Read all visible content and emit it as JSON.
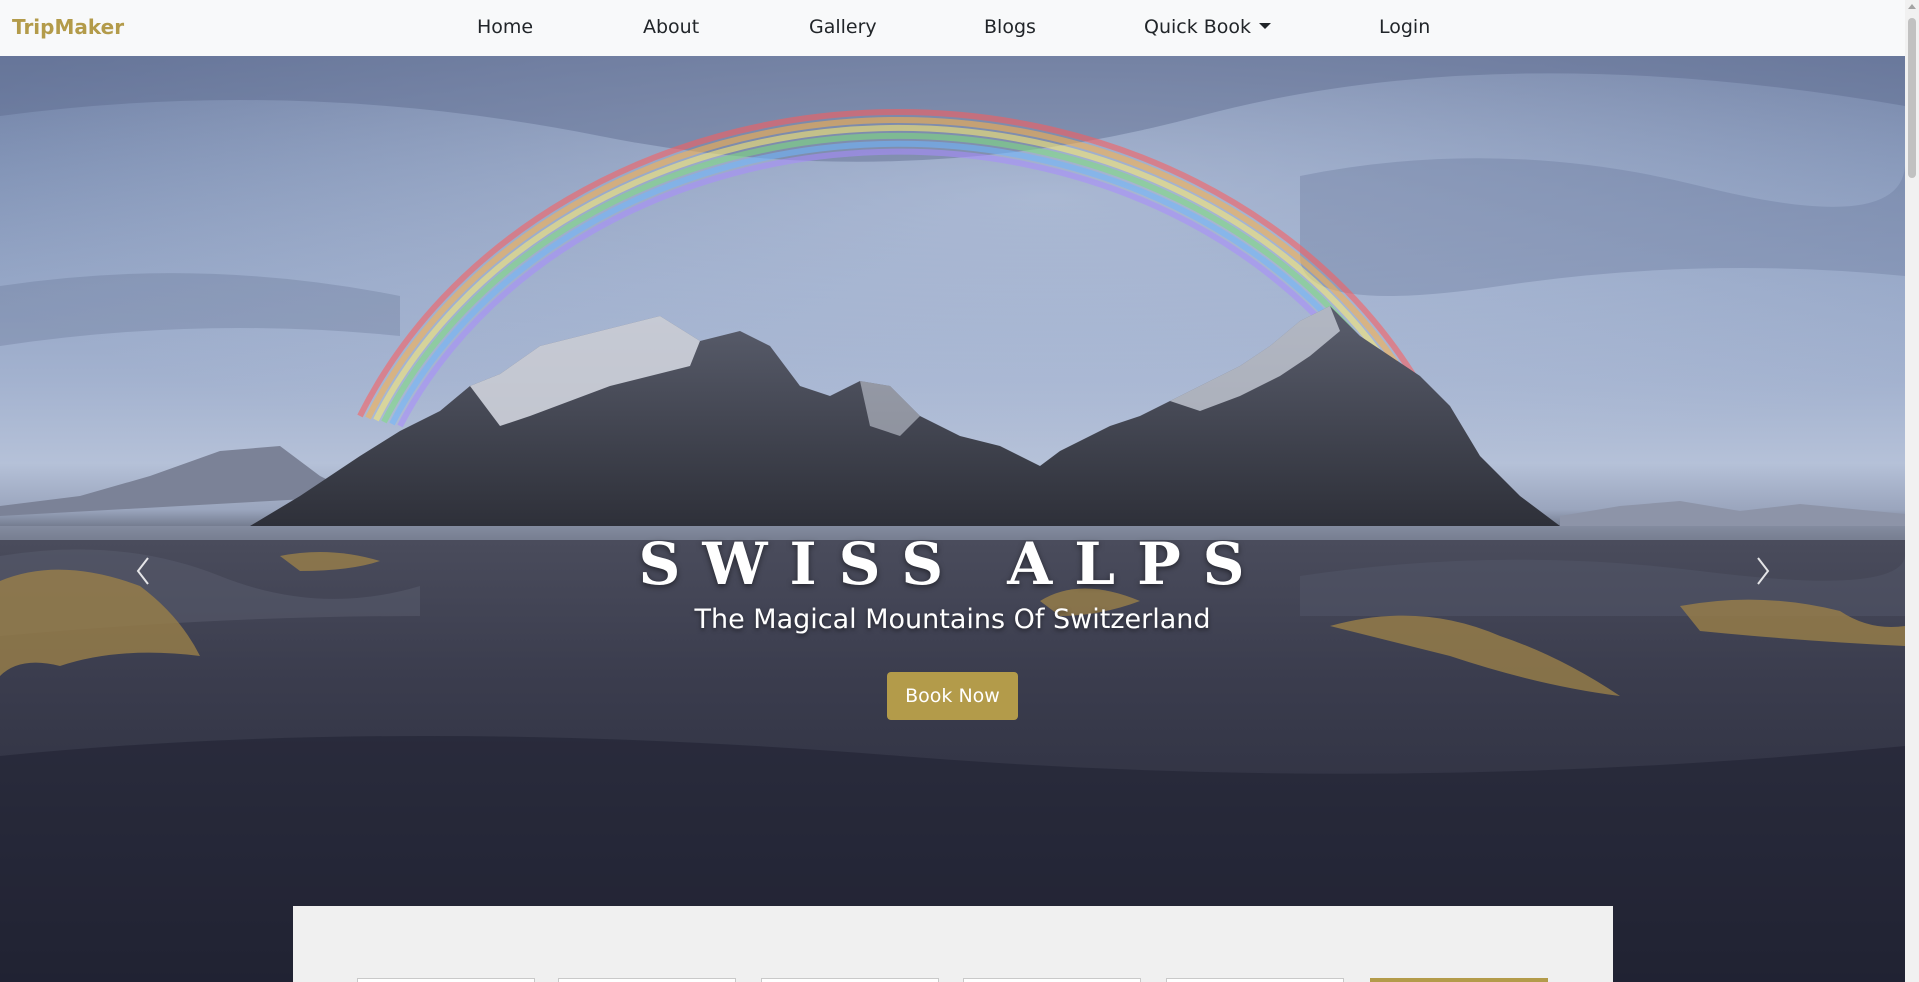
{
  "navbar": {
    "brand": "TripMaker",
    "items": [
      {
        "label": "Home"
      },
      {
        "label": "About"
      },
      {
        "label": "Gallery"
      },
      {
        "label": "Blogs"
      },
      {
        "label": "Quick Book"
      },
      {
        "label": "Login"
      }
    ]
  },
  "hero": {
    "title": "SWISS ALPS",
    "subtitle": "The Magical Mountains Of Switzerland",
    "cta_label": "Book Now"
  },
  "icons": {
    "prev": "chevron-left-icon",
    "next": "chevron-right-icon",
    "dropdown": "caret-down-icon"
  },
  "colors": {
    "brand": "#b39b4a",
    "nav_bg": "#f8f9fa",
    "text": "#212529",
    "panel_bg": "#f0f0f0"
  }
}
